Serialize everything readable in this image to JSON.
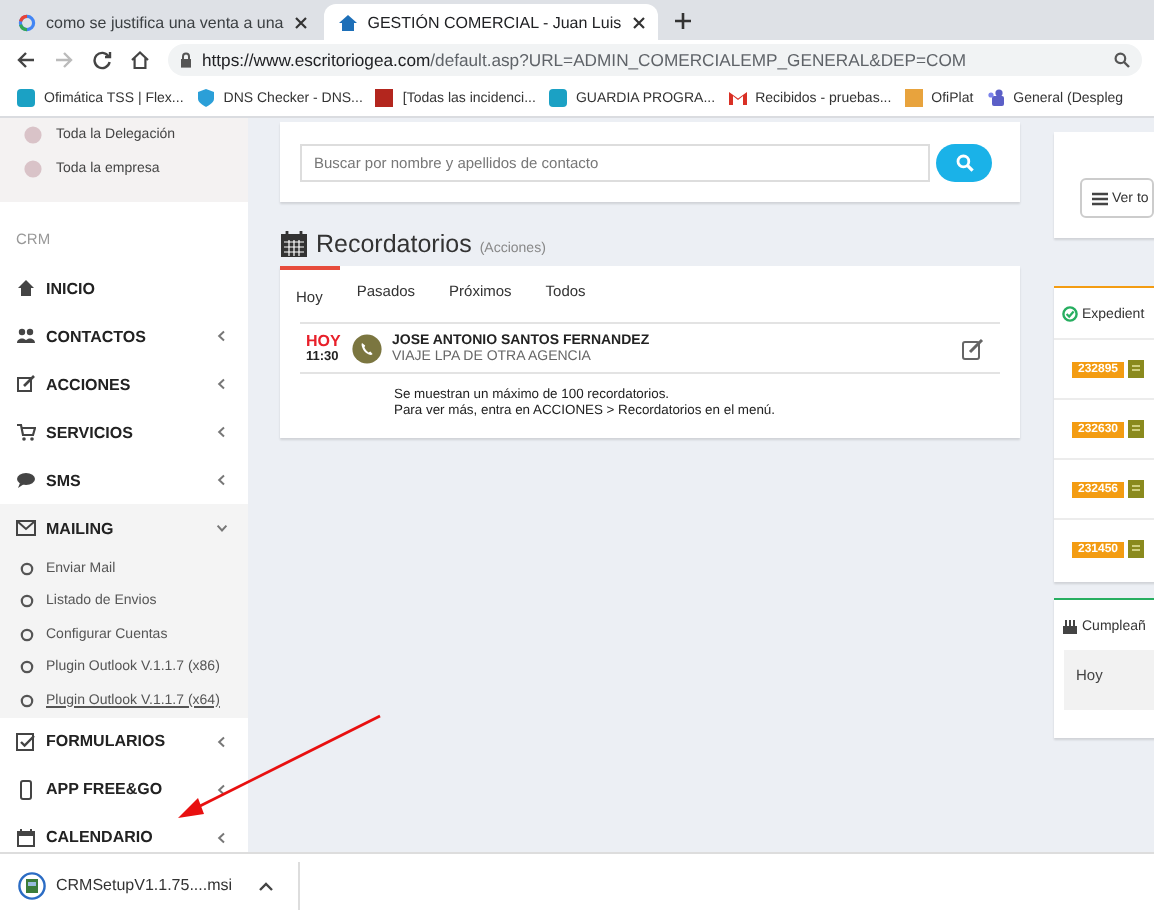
{
  "browser_tabs": [
    {
      "title": "como se justifica una venta a una",
      "selected": false
    },
    {
      "title": "GESTIÓN COMERCIAL - Juan Luis",
      "selected": true
    }
  ],
  "address_bar": {
    "url_host": "https://www.escritoriogea.com",
    "url_path": "/default.asp?URL=ADMIN_COMERCIALEMP_GENERAL&DEP=COM"
  },
  "bookmarks": [
    "Ofimática TSS | Flex...",
    "DNS Checker - DNS...",
    "[Todas las incidenci...",
    "GUARDIA PROGRA...",
    "Recibidos - pruebas...",
    "OfiPlat",
    "General (Despleg"
  ],
  "sidebar": {
    "scope_options": [
      "Toda la Delegación",
      "Toda la empresa"
    ],
    "section_label": "CRM",
    "menu": [
      {
        "label": "INICIO",
        "kind": "link"
      },
      {
        "label": "CONTACTOS",
        "kind": "group",
        "expanded": false
      },
      {
        "label": "ACCIONES",
        "kind": "group",
        "expanded": false
      },
      {
        "label": "SERVICIOS",
        "kind": "group",
        "expanded": false
      },
      {
        "label": "SMS",
        "kind": "group",
        "expanded": false
      },
      {
        "label": "MAILING",
        "kind": "group",
        "expanded": true,
        "children": [
          {
            "label": "Enviar Mail",
            "hovered": false
          },
          {
            "label": "Listado de Envios",
            "hovered": false
          },
          {
            "label": "Configurar Cuentas",
            "hovered": false
          },
          {
            "label": "Plugin Outlook V.1.1.7 (x86)",
            "hovered": false
          },
          {
            "label": "Plugin Outlook V.1.1.7 (x64)",
            "hovered": true
          }
        ]
      },
      {
        "label": "FORMULARIOS",
        "kind": "group",
        "expanded": false
      },
      {
        "label": "APP FREE&GO",
        "kind": "group",
        "expanded": false
      },
      {
        "label": "CALENDARIO",
        "kind": "group",
        "expanded": false
      }
    ]
  },
  "search": {
    "placeholder": "Buscar por nombre y apellidos de contacto"
  },
  "reminders": {
    "title": "Recordatorios",
    "subtitle": "(Acciones)",
    "tabs": [
      {
        "label": "Hoy",
        "selected": true
      },
      {
        "label": "Pasados",
        "selected": false
      },
      {
        "label": "Próximos",
        "selected": false
      },
      {
        "label": "Todos",
        "selected": false
      }
    ],
    "items": [
      {
        "day": "HOY",
        "time": "11:30",
        "name": "JOSE ANTONIO SANTOS FERNANDEZ",
        "detail": "VIAJE LPA DE OTRA AGENCIA"
      }
    ],
    "notes": [
      "Se muestran un máximo de 100 recordatorios.",
      "Para ver más, entra en ACCIONES > Recordatorios en el menú."
    ]
  },
  "right_column": {
    "view_all_button": "Ver to",
    "files": {
      "title": "Expedient",
      "numbers": [
        "232895",
        "232630",
        "232456",
        "231450"
      ]
    },
    "birthdays": {
      "title": "Cumpleañ",
      "day_label": "Hoy"
    }
  },
  "download": {
    "filename": "CRMSetupV1.1.75....msi"
  }
}
